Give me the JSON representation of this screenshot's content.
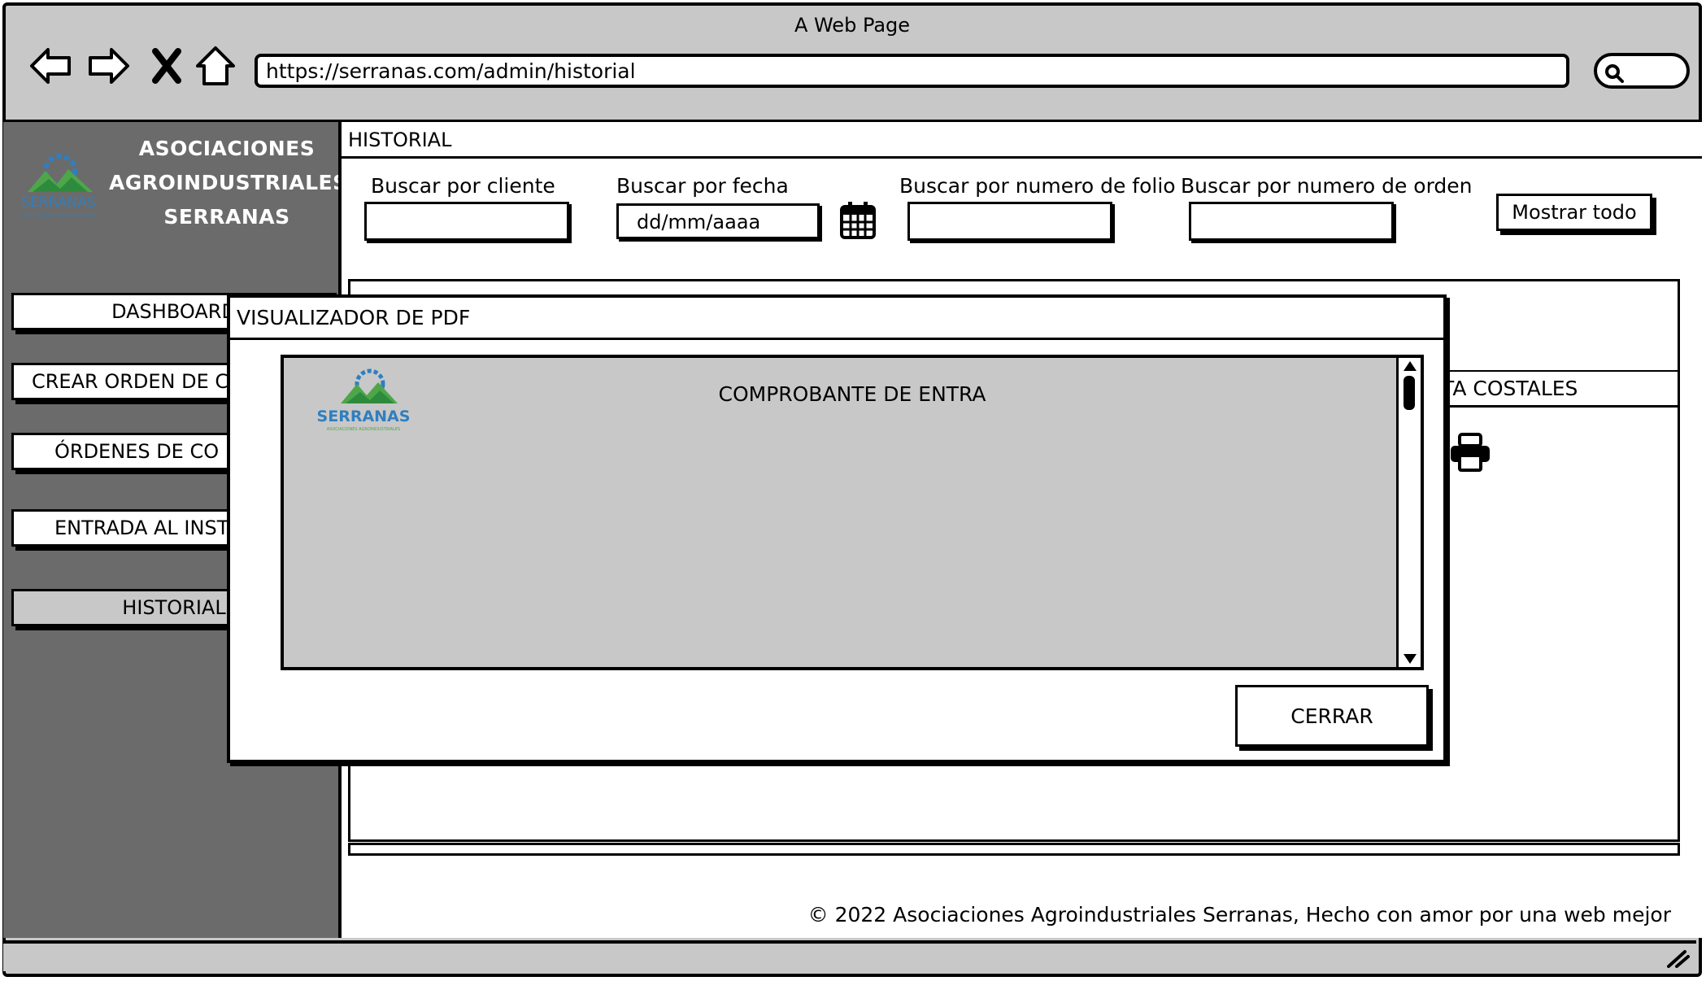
{
  "browser": {
    "title": "A Web Page",
    "url": "https://serranas.com/admin/historial"
  },
  "brand": {
    "line1": "ASOCIACIONES",
    "line2": "AGROINDUSTRIALES",
    "line3": "SERRANAS",
    "logo_text": "SERRANAS",
    "logo_subtext": "ASOCIACIONES AGROINDUSTRIALES",
    "colors": {
      "blue": "#2f7fbf",
      "green": "#4ea64a"
    }
  },
  "sidebar": {
    "items": [
      {
        "label": "DASHBOARD"
      },
      {
        "label": "CREAR ORDEN DE C"
      },
      {
        "label": "ÓRDENES DE CO"
      },
      {
        "label": "ENTRADA AL INST"
      },
      {
        "label": "HISTORIAL",
        "active": true
      }
    ]
  },
  "page": {
    "header": "HISTORIAL",
    "filters": {
      "cliente_label": "Buscar por cliente",
      "fecha_label": "Buscar por fecha",
      "fecha_placeholder": "dd/mm/aaaa",
      "folio_label": "Buscar por numero de folio",
      "orden_label": "Buscar por numero de orden"
    },
    "show_all": "Mostrar todo",
    "tab_partial": "TA COSTALES",
    "footer": "© 2022 Asociaciones Agroindustriales Serranas, Hecho con amor por una web mejor"
  },
  "modal": {
    "title": "VISUALIZADOR DE PDF",
    "document_heading": "COMPROBANTE DE ENTRA",
    "close_label": "CERRAR"
  }
}
